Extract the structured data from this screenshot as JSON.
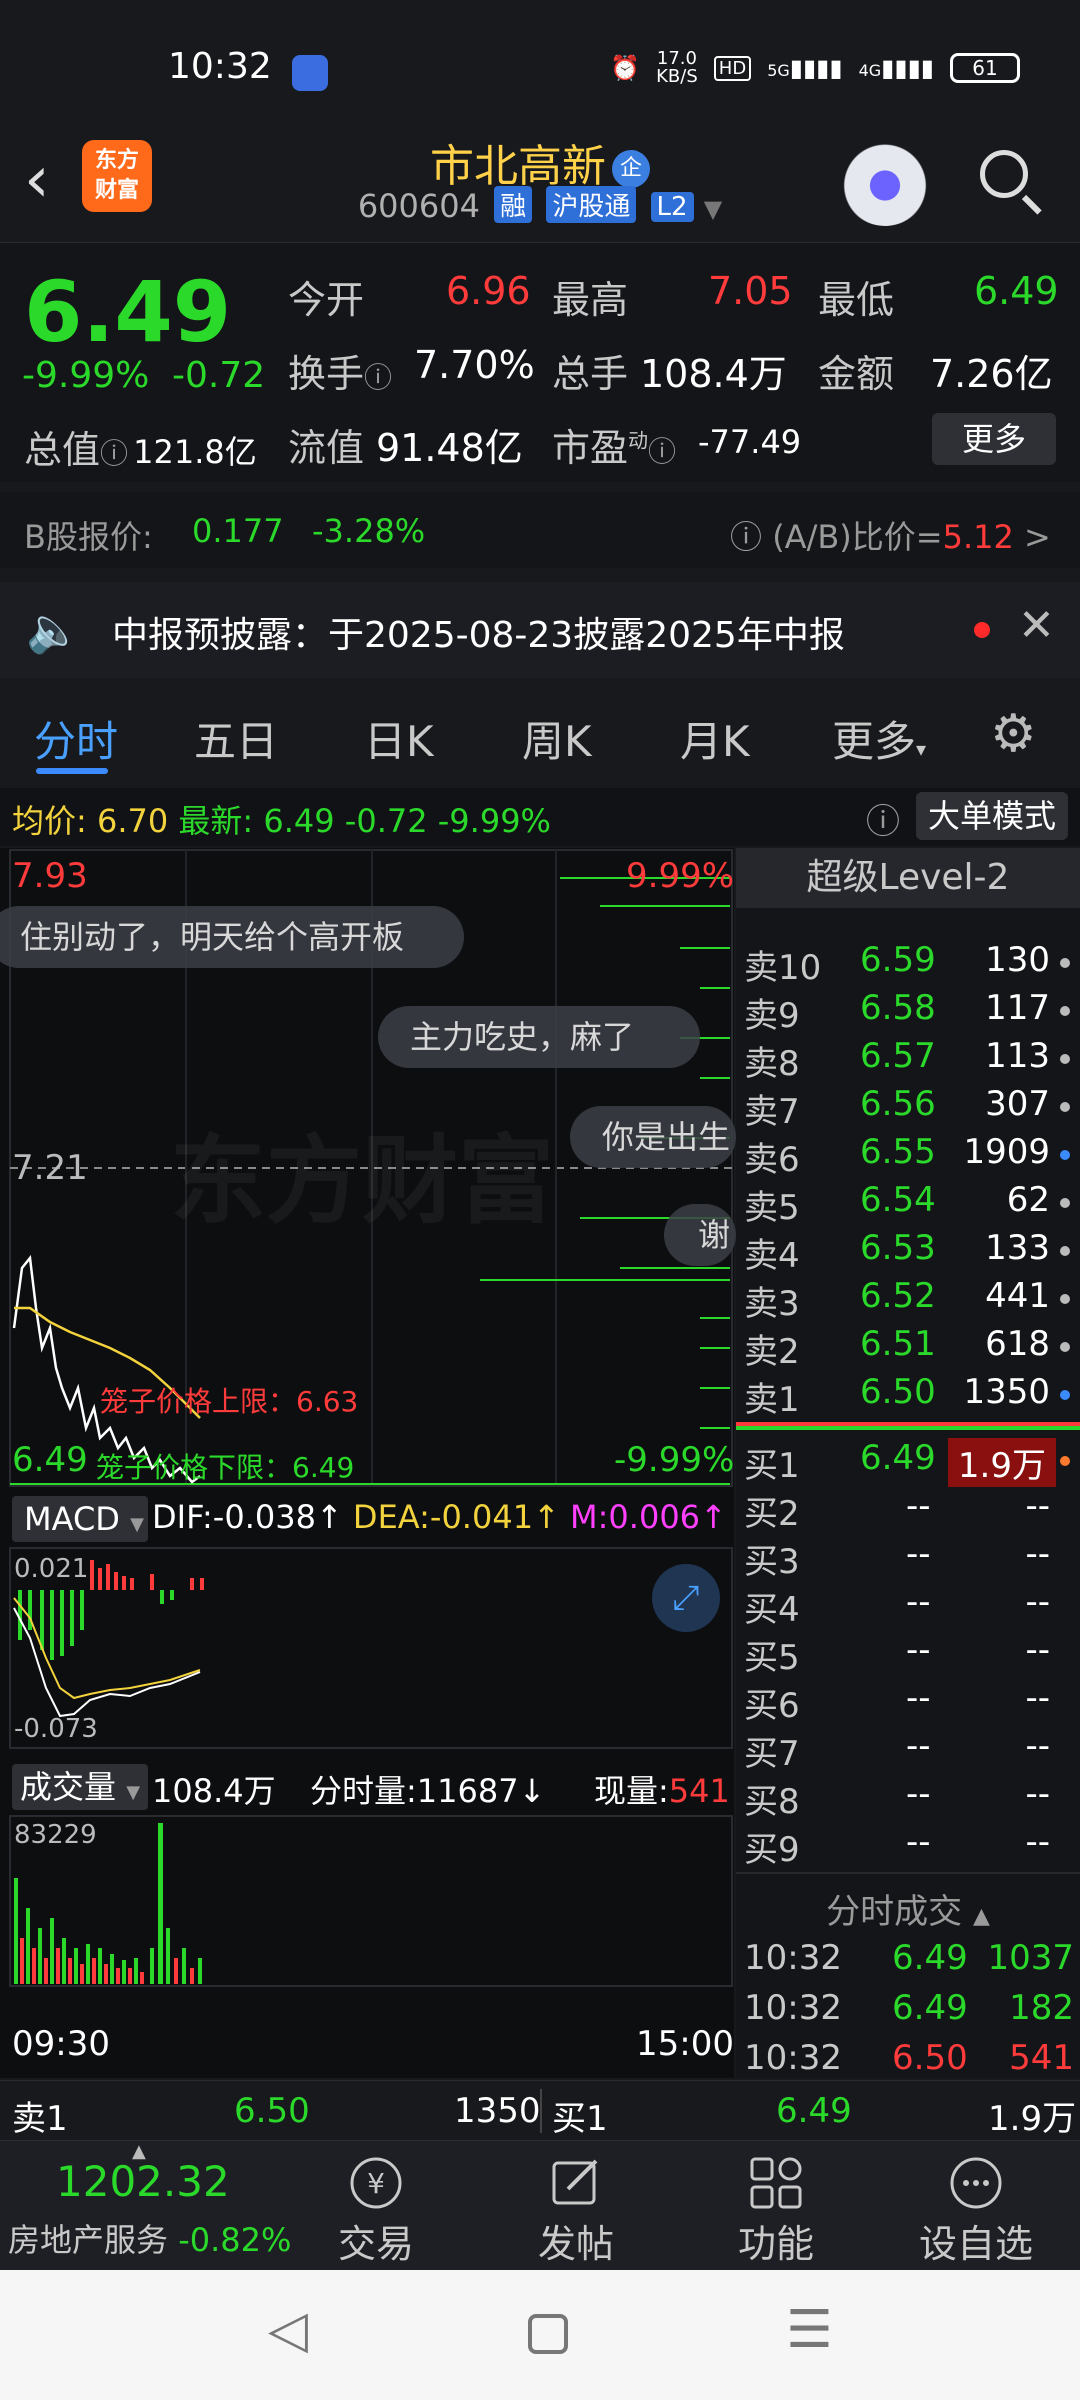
{
  "status_bar": {
    "time": "10:32",
    "net_speed_top": "17.0",
    "net_speed_unit": "KB/S",
    "hd": "HD",
    "sig1": "5G",
    "sig2": "4G",
    "battery": "61"
  },
  "header": {
    "logo_line1": "东方",
    "logo_line2": "财富",
    "stock_name": "市北高新",
    "name_badge": "企",
    "stock_code": "600604",
    "tags": [
      "融",
      "沪股通",
      "L2"
    ]
  },
  "quote": {
    "price": "6.49",
    "change_pct": "-9.99%",
    "change": "-0.72",
    "total_value_label": "总值",
    "total_value": "121.8亿",
    "open_label": "今开",
    "open": "6.96",
    "high_label": "最高",
    "high": "7.05",
    "low_label": "最低",
    "low": "6.49",
    "turnover_label": "换手",
    "turnover": "7.70%",
    "volume_label": "总手",
    "volume": "108.4万",
    "amount_label": "金额",
    "amount": "7.26亿",
    "float_label": "流值",
    "float": "91.48亿",
    "pe_label": "市盈",
    "pe_sup": "动",
    "pe": "-77.49",
    "more_button": "更多"
  },
  "bshare": {
    "label": "B股报价:",
    "price": "0.177",
    "pct": "-3.28%",
    "ratio_label": "(A/B)比价=",
    "ratio": "5.12",
    "arrow": ">"
  },
  "notice": {
    "text": "中报预披露：于2025-08-23披露2025年中报"
  },
  "tabs": [
    "分时",
    "五日",
    "日K",
    "周K",
    "月K",
    "更多"
  ],
  "info_line": {
    "avg_label": "均价:",
    "avg": "6.70",
    "latest_label": "最新:",
    "latest": "6.49",
    "chg": "-0.72",
    "pct": "-9.99%",
    "mode_button": "大单模式"
  },
  "chart": {
    "top_price": "7.93",
    "top_pct": "9.99%",
    "mid_price": "7.21",
    "bottom_price": "6.49",
    "bottom_pct": "-9.99%",
    "upper_limit": "笼子价格上限：6.63",
    "lower_limit": "笼子价格下限：6.49",
    "watermark": "东方财富",
    "danmu": [
      "住别动了，明天给个高开板",
      "主力吃史，麻了",
      "你是出生",
      "谢"
    ],
    "macd_label": "MACD",
    "dif": "DIF:-0.038",
    "dea": "DEA:-0.041",
    "m": "M:0.006",
    "macd_top": "0.021",
    "macd_bottom": "-0.073",
    "vol_label": "成交量",
    "vol_total": "108.4万",
    "vol_tick": "分时量:11687",
    "vol_now_label": "现量:",
    "vol_now": "541",
    "vol_max": "83229",
    "time_start": "09:30",
    "time_end": "15:00"
  },
  "book": {
    "header": "超级Level-2",
    "sell": [
      {
        "label": "卖10",
        "price": "6.59",
        "vol": "130"
      },
      {
        "label": "卖9",
        "price": "6.58",
        "vol": "117"
      },
      {
        "label": "卖8",
        "price": "6.57",
        "vol": "113"
      },
      {
        "label": "卖7",
        "price": "6.56",
        "vol": "307"
      },
      {
        "label": "卖6",
        "price": "6.55",
        "vol": "1909"
      },
      {
        "label": "卖5",
        "price": "6.54",
        "vol": "62"
      },
      {
        "label": "卖4",
        "price": "6.53",
        "vol": "133"
      },
      {
        "label": "卖3",
        "price": "6.52",
        "vol": "441"
      },
      {
        "label": "卖2",
        "price": "6.51",
        "vol": "618"
      },
      {
        "label": "卖1",
        "price": "6.50",
        "vol": "1350"
      }
    ],
    "buy": [
      {
        "label": "买1",
        "price": "6.49",
        "vol": "1.9万"
      },
      {
        "label": "买2",
        "price": "--",
        "vol": "--"
      },
      {
        "label": "买3",
        "price": "--",
        "vol": "--"
      },
      {
        "label": "买4",
        "price": "--",
        "vol": "--"
      },
      {
        "label": "买5",
        "price": "--",
        "vol": "--"
      },
      {
        "label": "买6",
        "price": "--",
        "vol": "--"
      },
      {
        "label": "买7",
        "price": "--",
        "vol": "--"
      },
      {
        "label": "买8",
        "price": "--",
        "vol": "--"
      },
      {
        "label": "买9",
        "price": "--",
        "vol": "--"
      }
    ],
    "ticks_header": "分时成交",
    "ticks": [
      {
        "time": "10:32",
        "price": "6.49",
        "vol": "1037"
      },
      {
        "time": "10:32",
        "price": "6.49",
        "vol": "182"
      },
      {
        "time": "10:32",
        "price": "6.50",
        "vol": "541"
      }
    ]
  },
  "strip": {
    "sell_label": "卖1",
    "sell_price": "6.50",
    "sell_vol": "1350",
    "buy_label": "买1",
    "buy_price": "6.49",
    "buy_vol": "1.9万"
  },
  "nav": {
    "index_value": "1202.32",
    "index_name": "房地产服务",
    "index_pct": "-0.82%",
    "trade": "交易",
    "post": "发帖",
    "func": "功能",
    "watch": "设自选"
  },
  "colors": {
    "up": "#ff3b3b",
    "down": "#2bd92b",
    "accent": "#3b8bff",
    "avg_line": "#f2d33d"
  }
}
